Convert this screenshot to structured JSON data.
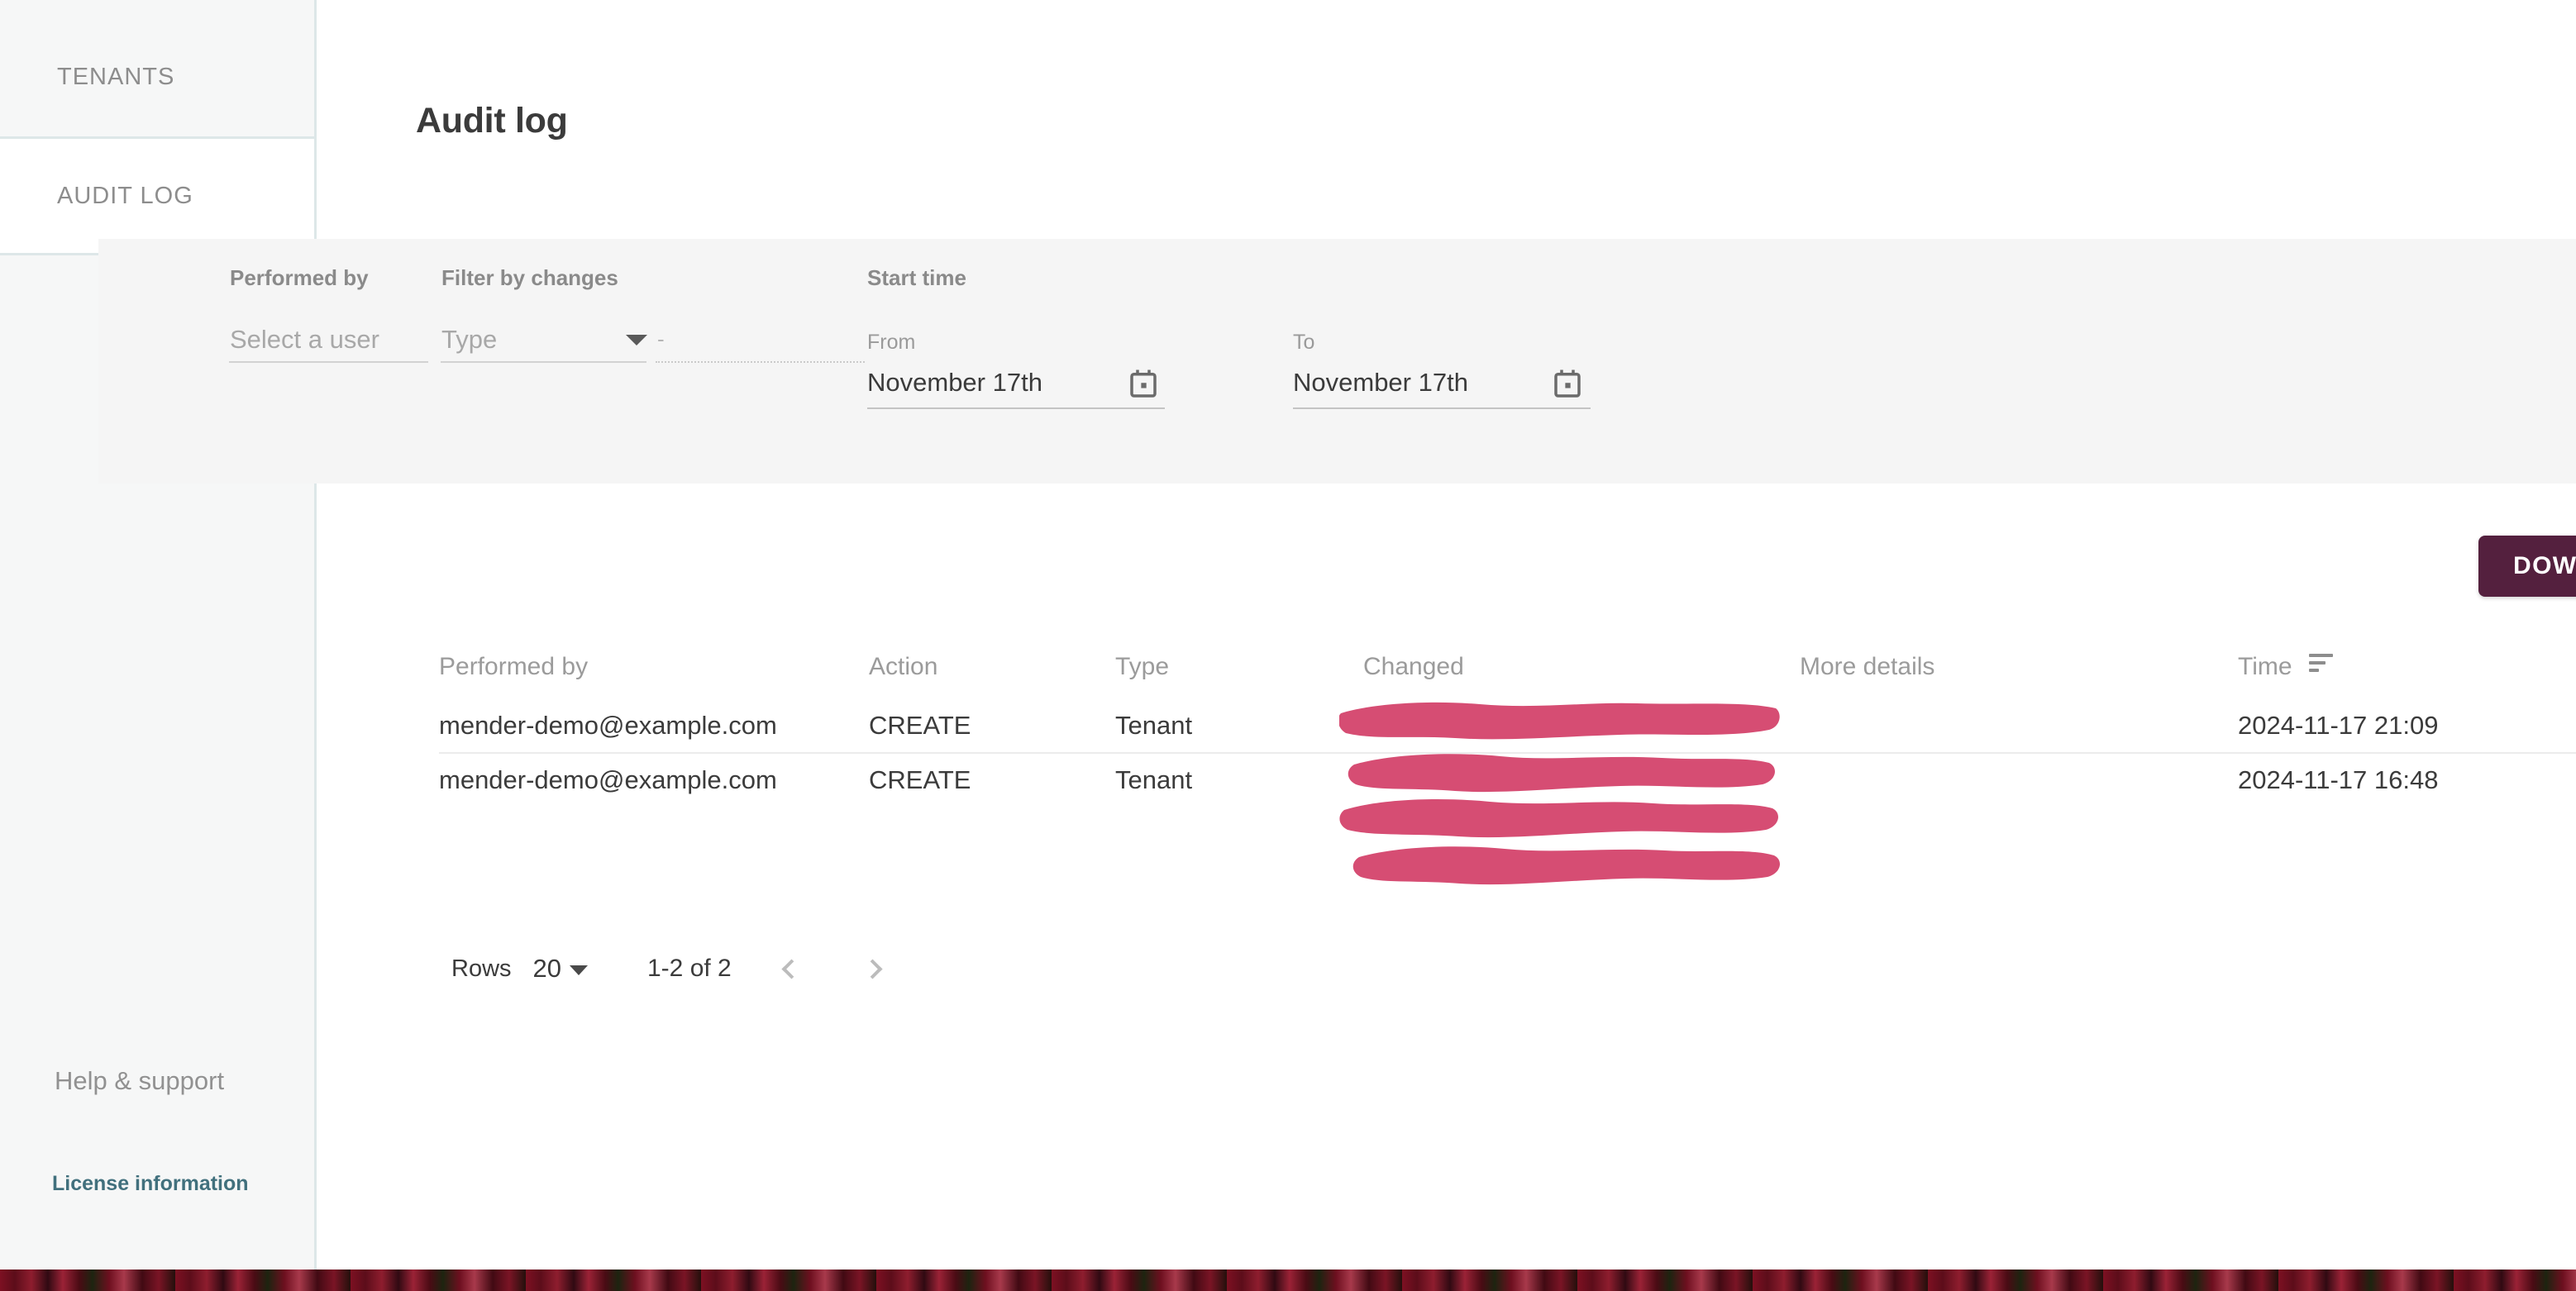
{
  "sidebar": {
    "items": [
      {
        "label": "TENANTS",
        "active": false
      },
      {
        "label": "AUDIT LOG",
        "active": true
      }
    ],
    "help_label": "Help & support",
    "license_label": "License information",
    "license_color": "#41707d",
    "border_color": "#dde7e8",
    "background": "#f6f7f7"
  },
  "header": {
    "title": "Audit log"
  },
  "filters": {
    "performed_by": {
      "label": "Performed by",
      "placeholder": "Select a user",
      "value": ""
    },
    "changes": {
      "label": "Filter by changes",
      "type_placeholder": "Type",
      "type_value": "",
      "detail_placeholder": "-",
      "detail_value": "",
      "detail_disabled": true
    },
    "start_time": {
      "label": "Start time",
      "from_label": "From",
      "from_value": "November 17th",
      "to_label": "To",
      "to_value": "November 17th",
      "calendar_icon": "calendar-icon"
    }
  },
  "toolbar": {
    "download_label": "DOWNLOAD",
    "download_color": "#54203e"
  },
  "table": {
    "columns": [
      {
        "key": "performed_by",
        "label": "Performed by"
      },
      {
        "key": "action",
        "label": "Action"
      },
      {
        "key": "type",
        "label": "Type"
      },
      {
        "key": "changed",
        "label": "Changed"
      },
      {
        "key": "more_details",
        "label": "More details"
      },
      {
        "key": "time",
        "label": "Time",
        "sorted": "desc",
        "sort_icon": "sort-descending-icon"
      }
    ],
    "rows": [
      {
        "performed_by": "mender-demo@example.com",
        "action": "CREATE",
        "type": "Tenant",
        "changed": "",
        "more_details": "",
        "time": "2024-11-17 21:09"
      },
      {
        "performed_by": "mender-demo@example.com",
        "action": "CREATE",
        "type": "Tenant",
        "changed": "",
        "more_details": "",
        "time": "2024-11-17 16:48"
      }
    ],
    "redaction": {
      "present": true,
      "color": "#d64d73",
      "covers_column": "changed",
      "stroke_count": 4
    }
  },
  "pagination": {
    "rows_label": "Rows",
    "rows_per_page": "20",
    "range_label": "1-2 of 2",
    "prev_icon": "chevron-left-icon",
    "next_icon": "chevron-right-icon"
  },
  "theme": {
    "accent": "#54203e",
    "link": "#41707d",
    "panel_bg": "#f5f5f5",
    "text": "#3b3b3b",
    "muted_text": "#9b9b9b"
  }
}
